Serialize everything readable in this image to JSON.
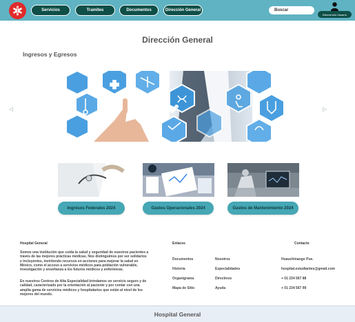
{
  "header": {
    "nav": [
      {
        "label": "Servicios"
      },
      {
        "label": "Tramites"
      },
      {
        "label": "Documentos"
      },
      {
        "label": "Dirección General"
      }
    ],
    "search_label": "Buscar",
    "user_label": "Bienvenido Usuario"
  },
  "main": {
    "title": "Dirección General",
    "section_title": "Ingresos y Egresos",
    "cards": [
      {
        "label": "Ingresos Federales 2024"
      },
      {
        "label": "Gastos Operacionales 2024"
      },
      {
        "label": "Gastos de Mantenimiento 2024"
      }
    ]
  },
  "footer": {
    "about_title": "Hospital General",
    "about_p1": [
      "Somos una institución que cuida la salud y seguridad de nuestros pacientes a",
      "través de las mejores prácticas médicas. Nos distinguimos por ser solidarios",
      "e incluyentes, invirtiendo recursos en acciones para mejorar la salud en",
      "México, como el acceso a servicios médicos para población vulnerable,",
      " investigación y enseñanza a los futuros médicos y enfermeras."
    ],
    "about_p2": [
      "En nuestros Centros de Alta Especialidad brindamos un servicio seguro y de",
      " calidad, caracterizado por la orientación al paciente y por contar con una",
      "amplia gama de servicios médicos y hospitalarios que están al nivel de los",
      "  mejores del mundo."
    ],
    "links_title": "Enlaces",
    "links_col1": [
      "Documentos",
      "Historia",
      "Organigrama",
      "Mapa de Sitio"
    ],
    "links_col2": [
      "Nosotros",
      "Especialidades",
      "Directivos",
      "Ayuda"
    ],
    "contact_title": "Contacto",
    "contact": [
      "Huauchinango Pue.",
      "hospital.estudiantes@gmail.com",
      "+ 01 234 567 88",
      "+ 01 234 567 99"
    ],
    "bottom_title": "Hospital General"
  },
  "colors": {
    "header": "#5fb3c2",
    "nav": "#0f4f48",
    "accent": "#46a7b5",
    "logo": "#e02b2b",
    "hex": "#4a9fe0"
  }
}
